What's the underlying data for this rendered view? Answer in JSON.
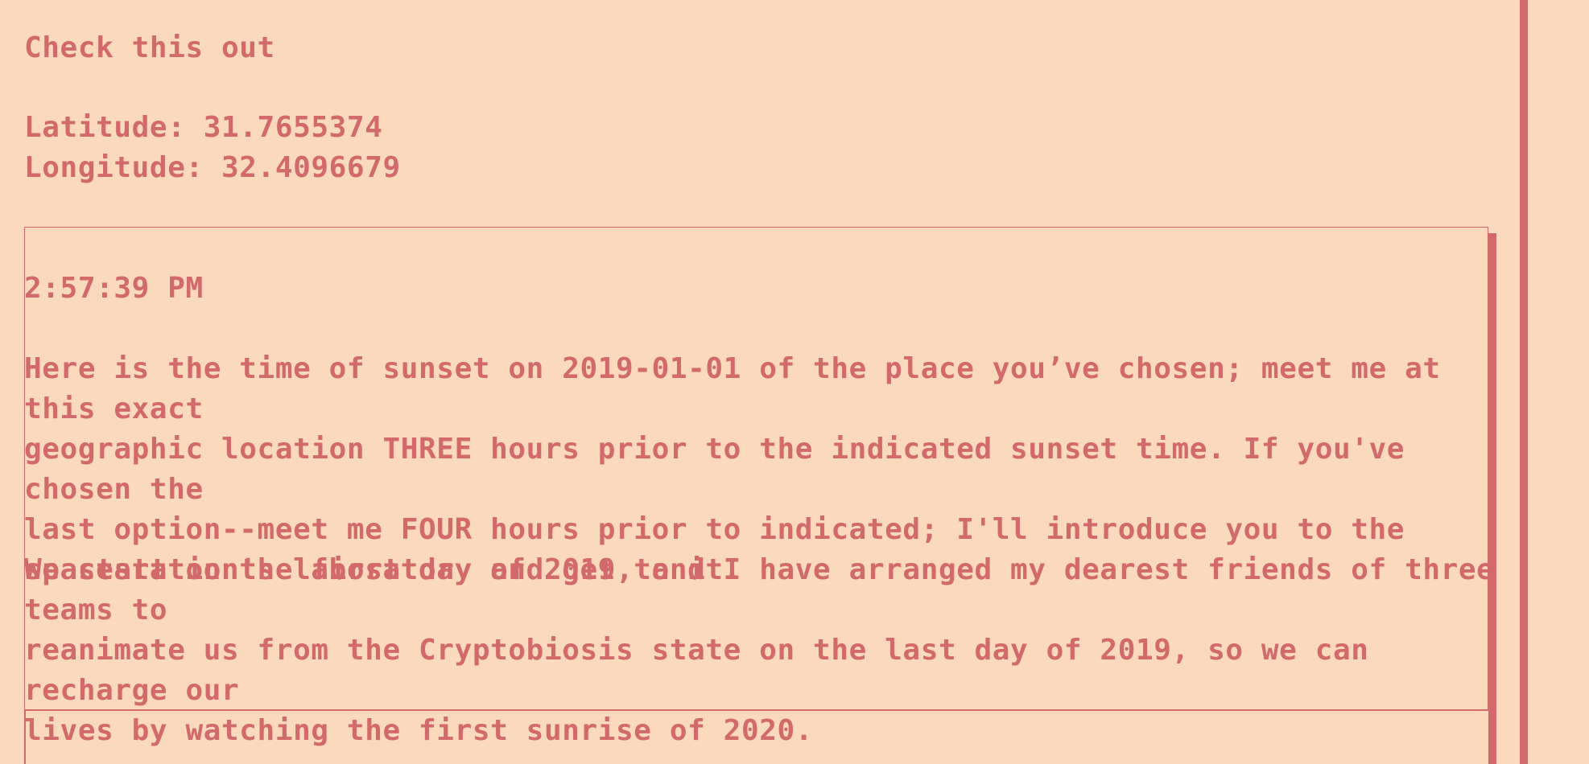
{
  "heading": "Check this out",
  "location": {
    "latitude_line": "Latitude: 31.7655374",
    "longitude_line": "Longitude: 32.4096679"
  },
  "panel": {
    "time": "2:57:39 PM",
    "paragraph_1": "Here is the time of sunset on 2019-01-01 of the place you’ve chosen; meet me at this exact\ngeographic location THREE hours prior to the indicated sunset time. If you've chosen the\nlast option--meet me FOUR hours prior to indicated; I'll introduce you to the\nspacestation's laboratory and get to it.",
    "paragraph_2": "We start on the first day of 2019, and I have arranged my dearest friends of three teams to\nreanimate us from the Cryptobiosis state on the last day of 2019, so we can recharge our\nlives by watching the first sunrise of 2020."
  },
  "colors": {
    "background": "#fbd9bd",
    "text": "#d2696a"
  }
}
